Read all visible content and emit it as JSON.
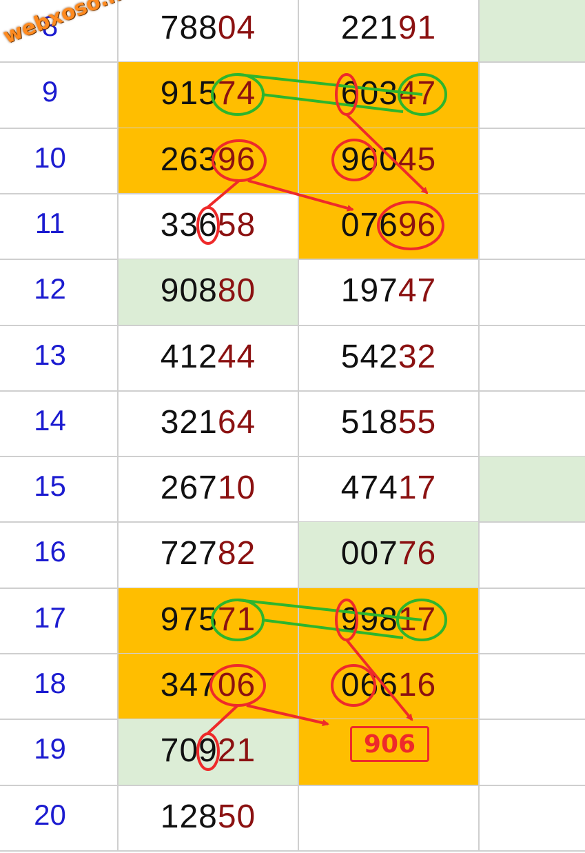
{
  "watermark": "webxoso.net",
  "prediction_badge": "906",
  "colors": {
    "day_number": "#1b1bd0",
    "digit_black": "#111111",
    "digit_red": "#8b1111",
    "highlight_orange": "#ffbe00",
    "highlight_green": "#dcedd6",
    "annotation_red": "#ee2a2a",
    "annotation_green": "#2db52d"
  },
  "rows": [
    {
      "day": "8",
      "a": {
        "lead": "788",
        "tail": "04",
        "bg": "white"
      },
      "b": {
        "lead": "221",
        "tail": "91",
        "bg": "white"
      },
      "c_bg": "green"
    },
    {
      "day": "9",
      "a": {
        "lead": "915",
        "tail": "74",
        "bg": "orange"
      },
      "b": {
        "lead": "603",
        "tail": "47",
        "bg": "orange"
      },
      "c_bg": "white"
    },
    {
      "day": "10",
      "a": {
        "lead": "263",
        "tail": "96",
        "bg": "orange"
      },
      "b": {
        "lead": "960",
        "tail": "45",
        "bg": "orange"
      },
      "c_bg": "white"
    },
    {
      "day": "11",
      "a": {
        "lead": "336",
        "tail": "58",
        "bg": "white"
      },
      "b": {
        "lead": "076",
        "tail": "96",
        "bg": "orange"
      },
      "c_bg": "white"
    },
    {
      "day": "12",
      "a": {
        "lead": "908",
        "tail": "80",
        "bg": "green"
      },
      "b": {
        "lead": "197",
        "tail": "47",
        "bg": "white"
      },
      "c_bg": "white"
    },
    {
      "day": "13",
      "a": {
        "lead": "412",
        "tail": "44",
        "bg": "white"
      },
      "b": {
        "lead": "542",
        "tail": "32",
        "bg": "white"
      },
      "c_bg": "white"
    },
    {
      "day": "14",
      "a": {
        "lead": "321",
        "tail": "64",
        "bg": "white"
      },
      "b": {
        "lead": "518",
        "tail": "55",
        "bg": "white"
      },
      "c_bg": "white"
    },
    {
      "day": "15",
      "a": {
        "lead": "267",
        "tail": "10",
        "bg": "white"
      },
      "b": {
        "lead": "474",
        "tail": "17",
        "bg": "white"
      },
      "c_bg": "green"
    },
    {
      "day": "16",
      "a": {
        "lead": "727",
        "tail": "82",
        "bg": "white"
      },
      "b": {
        "lead": "007",
        "tail": "76",
        "bg": "green"
      },
      "c_bg": "white"
    },
    {
      "day": "17",
      "a": {
        "lead": "975",
        "tail": "71",
        "bg": "orange"
      },
      "b": {
        "lead": "998",
        "tail": "17",
        "bg": "orange"
      },
      "c_bg": "white"
    },
    {
      "day": "18",
      "a": {
        "lead": "347",
        "tail": "06",
        "bg": "orange"
      },
      "b": {
        "lead": "066",
        "tail": "16",
        "bg": "orange"
      },
      "c_bg": "white"
    },
    {
      "day": "19",
      "a": {
        "lead": "709",
        "tail": "21",
        "bg": "green"
      },
      "b": {
        "lead": "",
        "tail": "",
        "bg": "orange"
      },
      "c_bg": "white"
    },
    {
      "day": "20",
      "a": {
        "lead": "128",
        "tail": "50",
        "bg": "white"
      },
      "b": {
        "lead": "",
        "tail": "",
        "bg": "white"
      },
      "c_bg": "white"
    }
  ]
}
